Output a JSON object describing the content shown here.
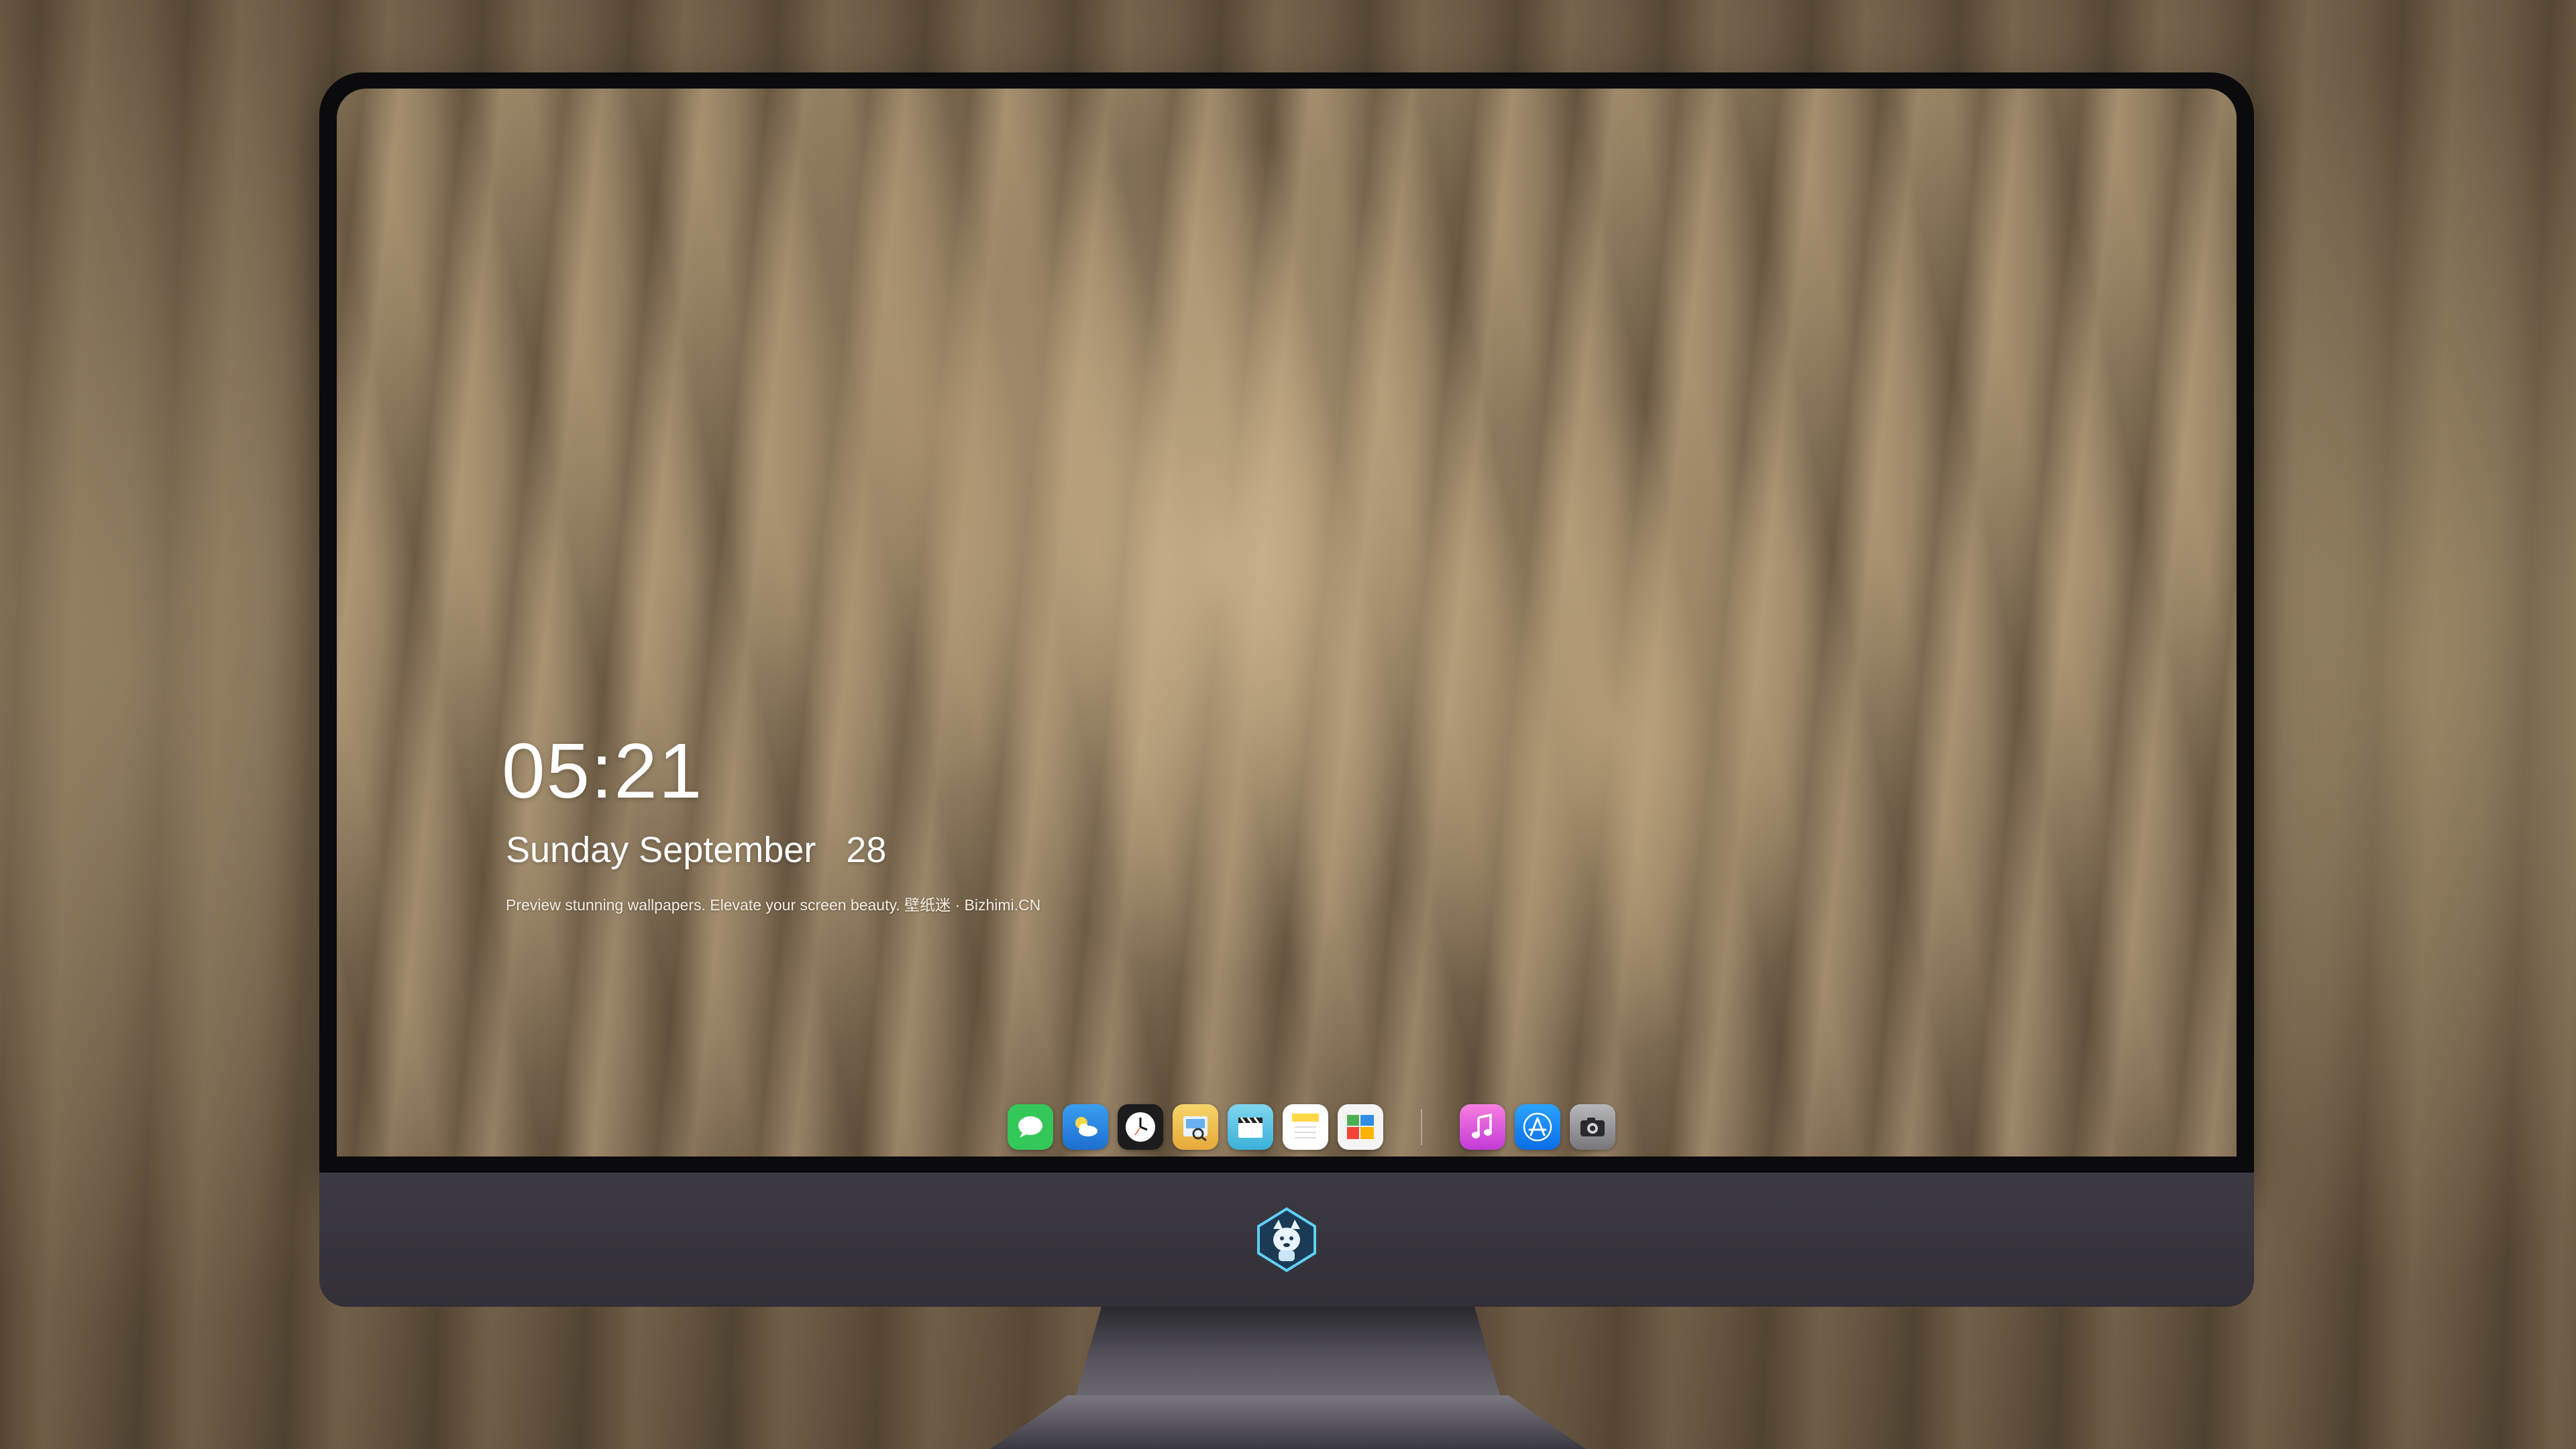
{
  "lockscreen": {
    "time": "05:21",
    "date": "Sunday September   28",
    "tagline": "Preview stunning wallpapers. Elevate your screen beauty. 壁纸迷 · Bizhimi.CN"
  },
  "dock": {
    "apps": [
      {
        "name": "messages-icon",
        "color": "#34c759"
      },
      {
        "name": "weather-icon",
        "color": "#2f8de4"
      },
      {
        "name": "clock-icon",
        "color": "#1c1c1e"
      },
      {
        "name": "preview-icon",
        "color": "#f3c94a"
      },
      {
        "name": "claquette-icon",
        "color": "#5ac8e8"
      },
      {
        "name": "notes-icon",
        "color": "#ffd84a"
      },
      {
        "name": "photo-collage-icon",
        "color": "#ffffff"
      },
      {
        "name": "music-icon",
        "color": "#e84bd0"
      },
      {
        "name": "app-store-icon",
        "color": "#1a8cff"
      },
      {
        "name": "camera-icon",
        "color": "#8e8e93"
      }
    ]
  },
  "monitor": {
    "brand_logo": "wolf-mascot-logo"
  }
}
